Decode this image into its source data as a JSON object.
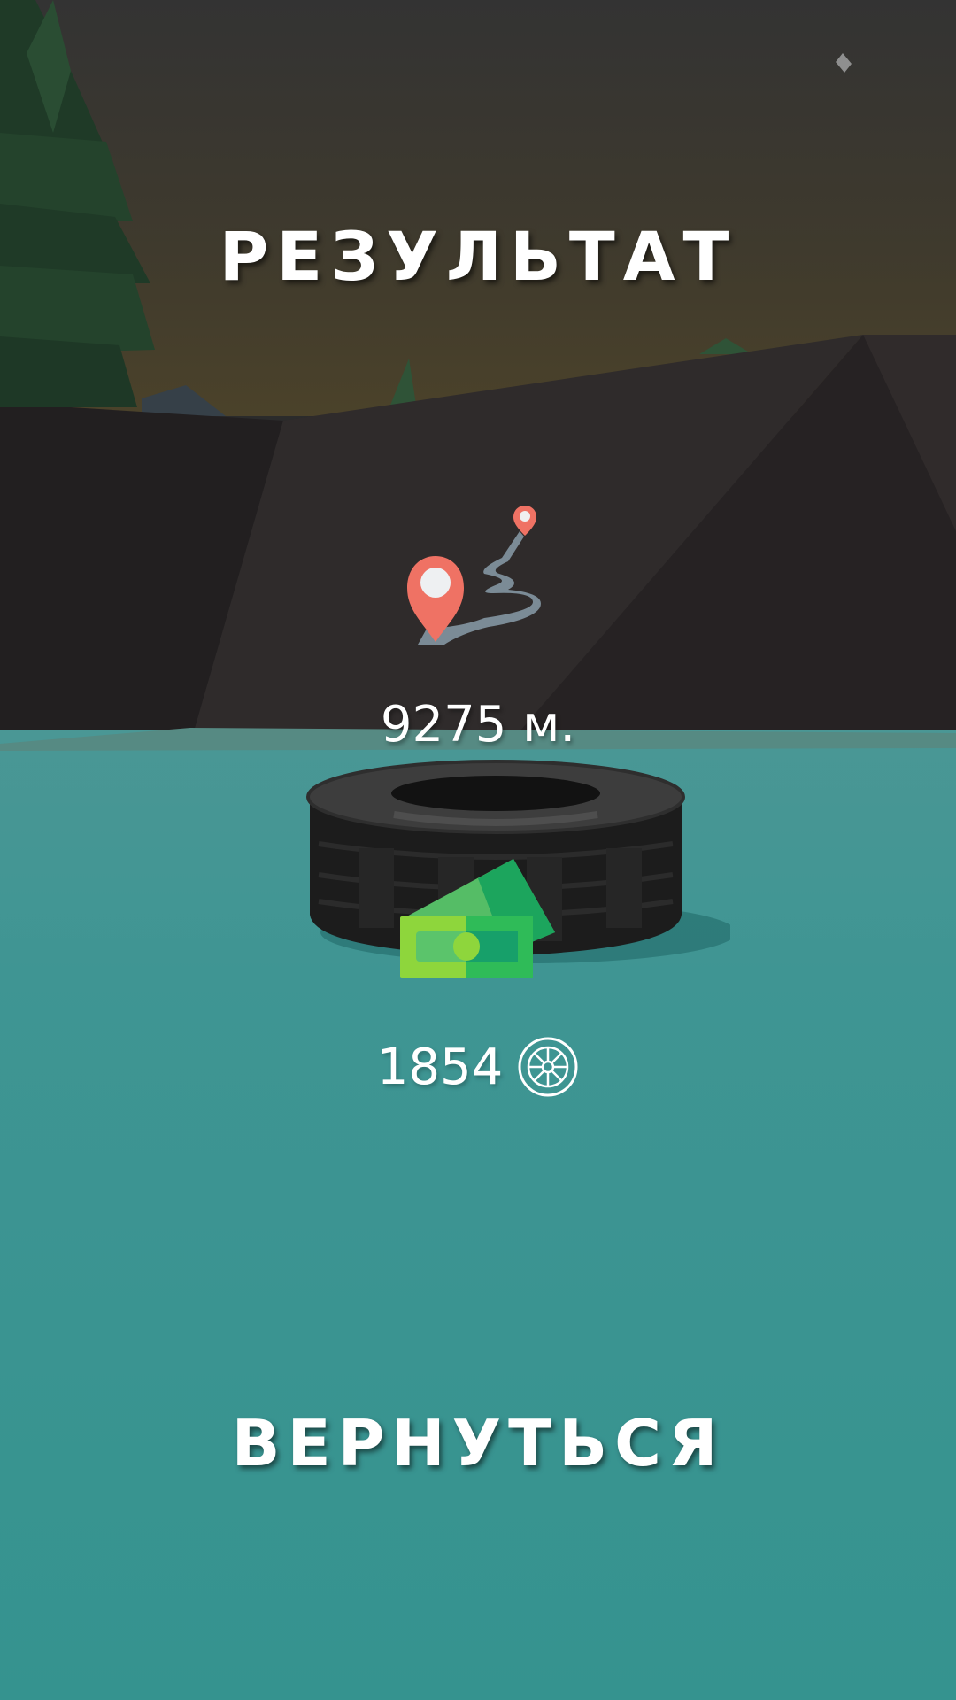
{
  "header": {
    "title": "РЕЗУЛЬТАТ"
  },
  "stats": {
    "distance": "9275 м.",
    "coins": "1854"
  },
  "actions": {
    "return_label": "ВЕРНУТЬСЯ"
  },
  "icons": {
    "route": "route-map-pin-icon",
    "cash": "cash-bills-icon",
    "coin": "wheel-coin-icon"
  },
  "colors": {
    "sky_top": "#353535",
    "sky_horizon": "#473f2a",
    "mountain": "#2a2526",
    "ground": "#3a9491",
    "pin": "#ef7264",
    "route": "#7b8b96",
    "cash_light": "#8ed63c",
    "cash_dark": "#1ca55d"
  }
}
